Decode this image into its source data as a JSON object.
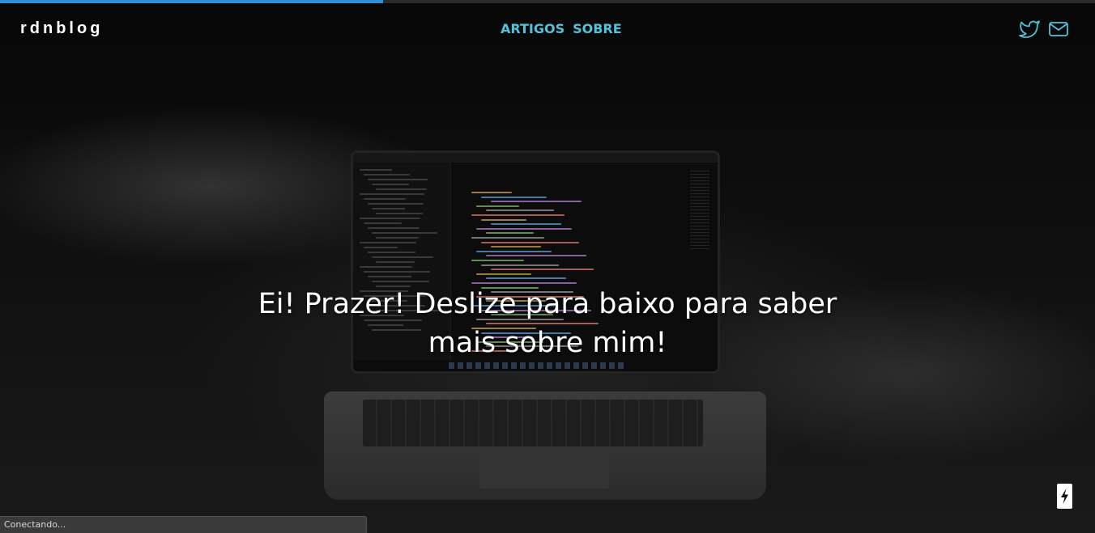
{
  "page": {
    "background_color": "#0b0b0b"
  },
  "progress": {
    "fraction": 0.35,
    "color": "#2f8fd6"
  },
  "header": {
    "logo": "rdnblog",
    "nav": [
      {
        "label": "ARTIGOS"
      },
      {
        "label": "SOBRE"
      }
    ],
    "accent_color": "#4fc3d9",
    "social": [
      {
        "icon": "twitter-icon"
      },
      {
        "icon": "mail-icon"
      }
    ]
  },
  "hero": {
    "title_line1": "Ei! Prazer! Deslize para baixo para saber",
    "title_line2": "mais sobre mim!"
  },
  "floating_button": {
    "icon": "lightning-bolt-icon"
  },
  "status_bar": {
    "text": "Conectando..."
  }
}
